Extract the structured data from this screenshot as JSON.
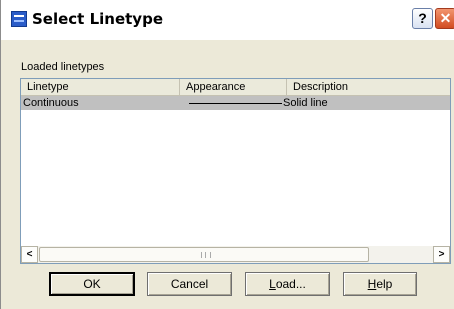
{
  "window": {
    "title": "Select Linetype",
    "help_glyph": "?",
    "close_glyph": "✕"
  },
  "group": {
    "label": "Loaded linetypes"
  },
  "table": {
    "columns": [
      "Linetype",
      "Appearance",
      "Description"
    ],
    "rows": [
      {
        "linetype": "Continuous",
        "appearance": "solid-line",
        "description": "Solid line"
      }
    ]
  },
  "scrollbar": {
    "left_glyph": "<",
    "right_glyph": ">"
  },
  "buttons": {
    "ok": "OK",
    "cancel": "Cancel",
    "load": {
      "mnemonic": "L",
      "rest": "oad..."
    },
    "help": {
      "mnemonic": "H",
      "rest": "elp"
    }
  },
  "colors": {
    "selection": "#c0c0c0",
    "dialog_bg": "#ece9d8",
    "list_border": "#7f9db9"
  }
}
